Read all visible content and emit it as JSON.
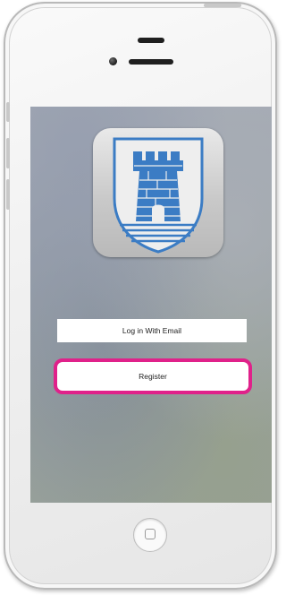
{
  "screen": {
    "app_icon": {
      "icon": "castle-tower-shield-icon",
      "colors": {
        "tower": "#3b7cc4",
        "shield_border": "#3b7cc4",
        "water_lines": "#3b7cc4"
      }
    },
    "login_button": {
      "label": "Log in With Email"
    },
    "register_button": {
      "label": "Register",
      "highlight_color": "#e0218a"
    }
  },
  "device": {
    "home_button_icon": "home-square-icon",
    "camera_icon": "front-camera-icon",
    "speaker_icon": "earpiece-speaker-icon"
  }
}
